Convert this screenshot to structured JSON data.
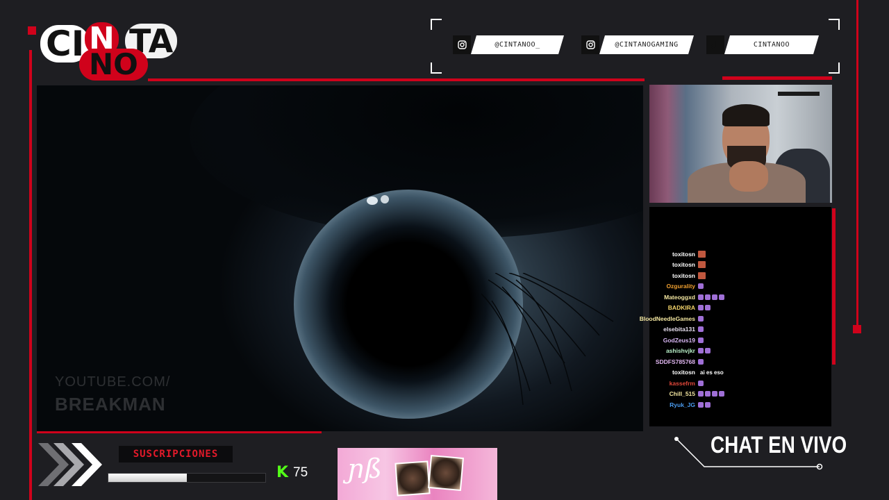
{
  "logo": {
    "part_ci": "CI",
    "part_n": "N",
    "part_ta": "TA",
    "part_no": "NO"
  },
  "socials": [
    {
      "icon": "instagram-icon",
      "handle": "@CINTANOO_"
    },
    {
      "icon": "instagram-icon",
      "handle": "@CINTANOGAMING"
    },
    {
      "icon": "tiktok-icon",
      "handle": "CINTANOO"
    }
  ],
  "video": {
    "watermark_line1": "YOUTUBE.COM/",
    "watermark_line2": "BREAKMAN"
  },
  "chat": {
    "messages": [
      {
        "user": "toxitosn",
        "color": "#ffffff",
        "badges": [
          "face"
        ],
        "text": ""
      },
      {
        "user": "toxitosn",
        "color": "#ffffff",
        "badges": [
          "face"
        ],
        "text": ""
      },
      {
        "user": "toxitosn",
        "color": "#ffffff",
        "badges": [
          "face"
        ],
        "text": ""
      },
      {
        "user": "Ozgurality",
        "color": "#f0a030",
        "badges": [
          "sub"
        ],
        "text": ""
      },
      {
        "user": "Mateoggxd",
        "color": "#f3e6a0",
        "badges": [
          "sub",
          "sub",
          "sub",
          "sub"
        ],
        "text": ""
      },
      {
        "user": "BADKIRA",
        "color": "#f3d36a",
        "badges": [
          "sub",
          "sub"
        ],
        "text": ""
      },
      {
        "user": "BloodNeedleGames",
        "color": "#f3e6a0",
        "badges": [
          "sub"
        ],
        "text": ""
      },
      {
        "user": "elsebita131",
        "color": "#e8e0f0",
        "badges": [
          "sub"
        ],
        "text": ""
      },
      {
        "user": "GodZeus19",
        "color": "#d7b6f3",
        "badges": [
          "sub"
        ],
        "text": ""
      },
      {
        "user": "ashishvjkr",
        "color": "#b8f0c8",
        "badges": [
          "sub",
          "sub"
        ],
        "text": ""
      },
      {
        "user": "SDDFS785768",
        "color": "#e0b6f0",
        "badges": [
          "sub"
        ],
        "text": ""
      },
      {
        "user": "toxitosn",
        "color": "#ffffff",
        "badges": [],
        "text": "ai es eso"
      },
      {
        "user": "kassefrm",
        "color": "#e0473a",
        "badges": [
          "sub"
        ],
        "text": ""
      },
      {
        "user": "Chill_515",
        "color": "#f3e6a0",
        "badges": [
          "sub",
          "sub",
          "sub",
          "sub"
        ],
        "text": ""
      },
      {
        "user": "Ryuk_JG",
        "color": "#4a9cf0",
        "badges": [
          "sub",
          "sub"
        ],
        "text": ""
      }
    ]
  },
  "subs": {
    "label": "SUSCRIPCIONES",
    "progress": 0.5,
    "kick_count": "75"
  },
  "chat_title": "CHAT EN VIVO",
  "colors": {
    "accent": "#d0021b",
    "kick": "#53fc18",
    "background": "#1e1e22"
  }
}
